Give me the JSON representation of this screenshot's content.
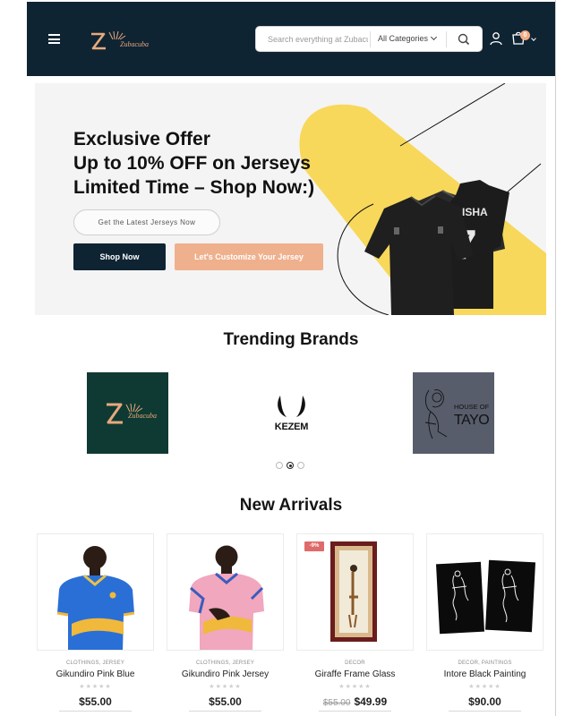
{
  "header": {
    "logo_text": "Zubacuba",
    "search": {
      "placeholder": "Search everything at Zubacuba",
      "category": "All Categories"
    },
    "cart_count": "0"
  },
  "hero": {
    "title_lines": [
      "Exclusive Offer",
      "Up to 10% OFF on Jerseys",
      "Limited Time – Shop Now:)"
    ],
    "pill": "Get the Latest Jerseys Now",
    "shop_button": "Shop Now",
    "customize_button": "Let's Customize Your Jersey",
    "jersey_name": "MUGISHA",
    "jersey_number": "7"
  },
  "trending": {
    "title": "Trending Brands",
    "brands": [
      {
        "label": "Zubacuba"
      },
      {
        "label": "KEZEM"
      },
      {
        "label_top": "HOUSE OF",
        "label_bottom": "TAYO"
      }
    ],
    "carousel_active": 2,
    "carousel_count": 3
  },
  "arrivals": {
    "title": "New Arrivals",
    "products": [
      {
        "category": "CLOTHINGS, JERSEY",
        "name": "Gikundiro Pink Blue",
        "price": "$55.00",
        "old_price": "",
        "badge": ""
      },
      {
        "category": "CLOTHINGS, JERSEY",
        "name": "Gikundiro Pink Jersey",
        "price": "$55.00",
        "old_price": "",
        "badge": ""
      },
      {
        "category": "DECOR",
        "name": "Giraffe Frame Glass",
        "price": "$49.99",
        "old_price": "$55.00",
        "badge": "-9%"
      },
      {
        "category": "DECOR, PAINTINGS",
        "name": "Intore Black Painting",
        "price": "$90.00",
        "old_price": "",
        "badge": ""
      }
    ],
    "stars_rating": 0
  },
  "colors": {
    "navy": "#0f2433",
    "peach": "#efb08d",
    "hero_yellow": "#f7d85a"
  }
}
